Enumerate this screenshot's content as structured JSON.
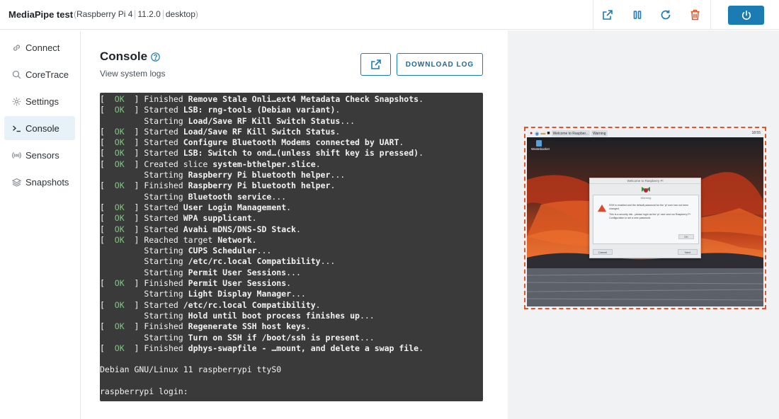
{
  "header": {
    "app_title": "MediaPipe test",
    "device_name": "Raspberry Pi 4",
    "os_version": "11.2.0",
    "mode": "desktop"
  },
  "sidebar": {
    "items": [
      {
        "label": "Connect",
        "icon": "link-icon"
      },
      {
        "label": "CoreTrace",
        "icon": "search-icon"
      },
      {
        "label": "Settings",
        "icon": "gear-icon"
      },
      {
        "label": "Console",
        "icon": "terminal-icon",
        "active": true
      },
      {
        "label": "Sensors",
        "icon": "broadcast-icon"
      },
      {
        "label": "Snapshots",
        "icon": "layers-icon"
      }
    ]
  },
  "main": {
    "title": "Console",
    "subtitle": "View system logs",
    "download_label": "DOWNLOAD LOG"
  },
  "console": {
    "lines": [
      {
        "status": "OK",
        "text": "Finished ",
        "bold": "Remove Stale Onli…ext4 Metadata Check Snapshots",
        "tail": "."
      },
      {
        "status": "OK",
        "text": "Started ",
        "bold": "LSB: rng-tools (Debian variant)",
        "tail": "."
      },
      {
        "status": "",
        "text": "Starting ",
        "bold": "Load/Save RF Kill Switch Status",
        "tail": "..."
      },
      {
        "status": "OK",
        "text": "Started ",
        "bold": "Load/Save RF Kill Switch Status",
        "tail": "."
      },
      {
        "status": "OK",
        "text": "Started ",
        "bold": "Configure Bluetooth Modems connected by UART",
        "tail": "."
      },
      {
        "status": "OK",
        "text": "Started ",
        "bold": "LSB: Switch to ond…(unless shift key is pressed)",
        "tail": "."
      },
      {
        "status": "OK",
        "text": "Created slice ",
        "bold": "system-bthelper.slice",
        "tail": "."
      },
      {
        "status": "",
        "text": "Starting ",
        "bold": "Raspberry Pi bluetooth helper",
        "tail": "..."
      },
      {
        "status": "OK",
        "text": "Finished ",
        "bold": "Raspberry Pi bluetooth helper",
        "tail": "."
      },
      {
        "status": "",
        "text": "Starting ",
        "bold": "Bluetooth service",
        "tail": "..."
      },
      {
        "status": "OK",
        "text": "Started ",
        "bold": "User Login Management",
        "tail": "."
      },
      {
        "status": "OK",
        "text": "Started ",
        "bold": "WPA supplicant",
        "tail": "."
      },
      {
        "status": "OK",
        "text": "Started ",
        "bold": "Avahi mDNS/DNS-SD Stack",
        "tail": "."
      },
      {
        "status": "OK",
        "text": "Reached target ",
        "bold": "Network",
        "tail": "."
      },
      {
        "status": "",
        "text": "Starting ",
        "bold": "CUPS Scheduler",
        "tail": "..."
      },
      {
        "status": "",
        "text": "Starting ",
        "bold": "/etc/rc.local Compatibility",
        "tail": "..."
      },
      {
        "status": "",
        "text": "Starting ",
        "bold": "Permit User Sessions",
        "tail": "..."
      },
      {
        "status": "OK",
        "text": "Finished ",
        "bold": "Permit User Sessions",
        "tail": "."
      },
      {
        "status": "",
        "text": "Starting ",
        "bold": "Light Display Manager",
        "tail": "..."
      },
      {
        "status": "OK",
        "text": "Started ",
        "bold": "/etc/rc.local Compatibility",
        "tail": "."
      },
      {
        "status": "",
        "text": "Starting ",
        "bold": "Hold until boot process finishes up",
        "tail": "..."
      },
      {
        "status": "OK",
        "text": "Finished ",
        "bold": "Regenerate SSH host keys",
        "tail": "."
      },
      {
        "status": "",
        "text": "Starting ",
        "bold": "Turn on SSH if /boot/ssh is present",
        "tail": "..."
      },
      {
        "status": "OK",
        "text": "Finished ",
        "bold": "dphys-swapfile - …mount, and delete a swap file",
        "tail": "."
      }
    ],
    "banner": "Debian GNU/Linux 11 raspberrypi ttyS0",
    "prompt": "raspberrypi login:"
  },
  "preview": {
    "taskbar_items": [
      "Welcome to Raspber...",
      "Warning"
    ],
    "clock": "18:55",
    "desktop_icon_label": "Wastebasket",
    "window_title": "Welcome to Raspberry Pi",
    "dialog_title": "Warning",
    "dialog_message_1": "SSH is enabled and the default password for the 'pi' user has not been changed.",
    "dialog_message_2": "This is a security risk - please login as the 'pi' user and run Raspberry Pi Configuration to set a new password.",
    "ok_label": "OK",
    "cancel_label": "Cancel",
    "next_label": "Next"
  },
  "colors": {
    "accent": "#1a7cb3",
    "danger": "#e0552a",
    "console_bg": "#3a3a3a",
    "ok_green": "#7ec97e"
  }
}
